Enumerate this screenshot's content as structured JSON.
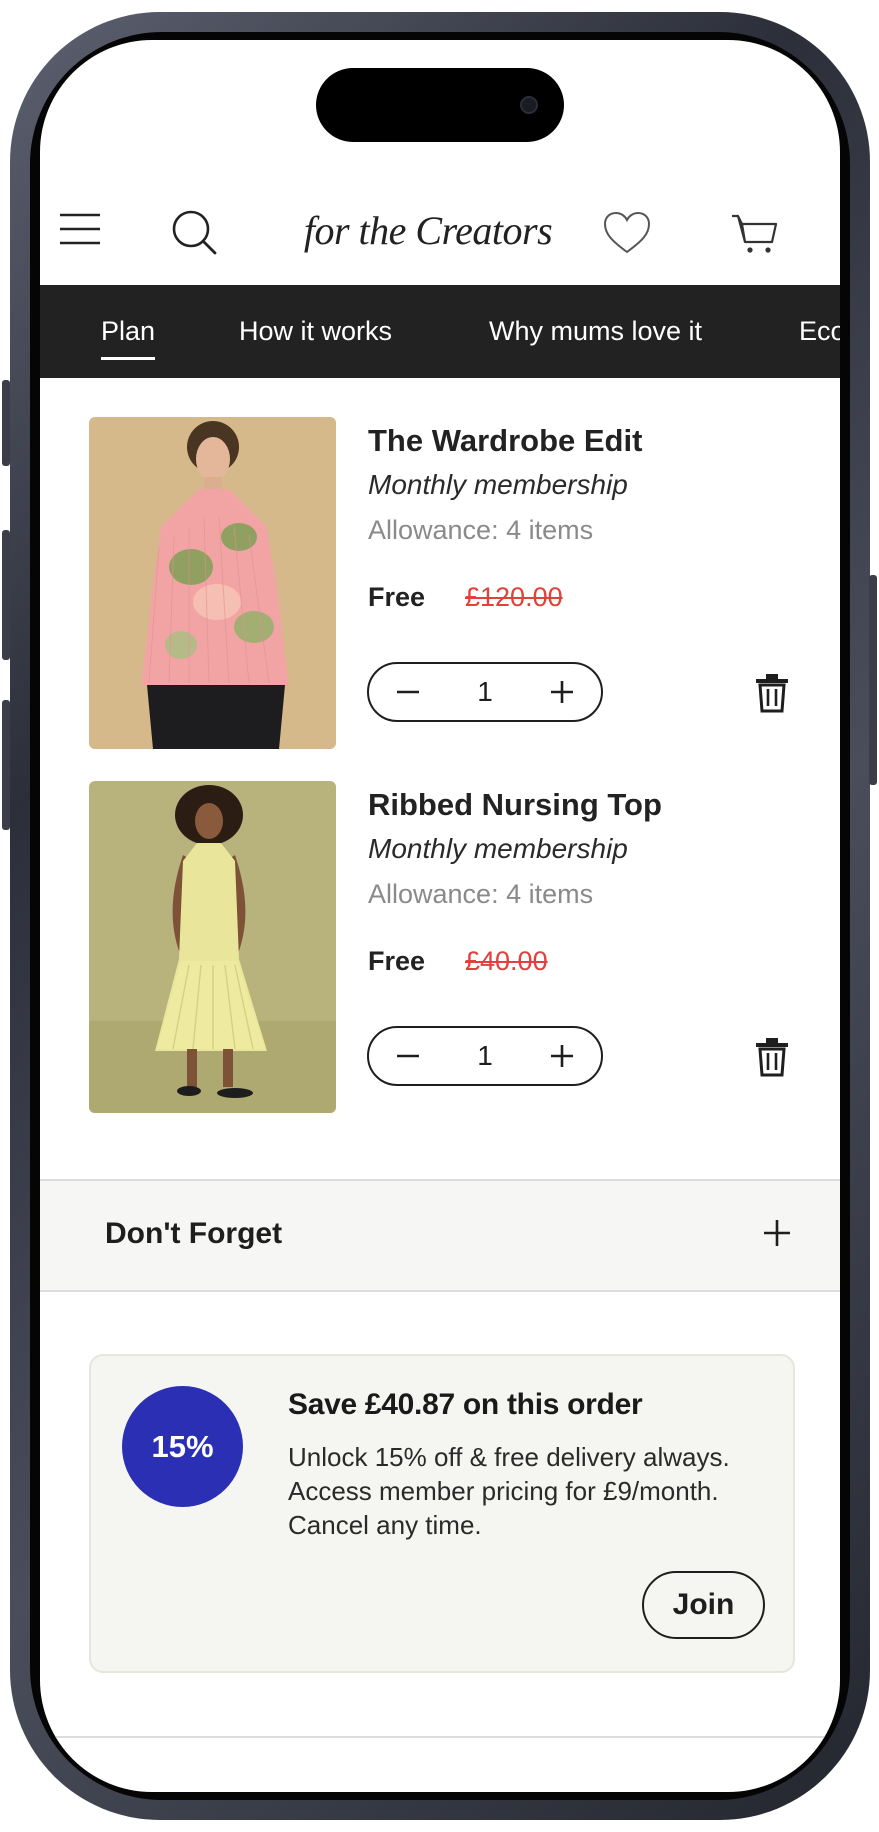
{
  "brand": {
    "logo_text": "for the Creators"
  },
  "header": {
    "icons": [
      "menu-icon",
      "search-icon",
      "heart-icon",
      "cart-icon"
    ]
  },
  "nav": {
    "tabs": [
      {
        "label": "Plan",
        "active": true
      },
      {
        "label": "How it works",
        "active": false
      },
      {
        "label": "Why mums love it",
        "active": false
      },
      {
        "label": "Eco",
        "active": false
      }
    ]
  },
  "cart": {
    "items": [
      {
        "name": "The Wardrobe Edit",
        "plan": "Monthly membership",
        "allowance": "Allowance: 4 items",
        "price": "Free",
        "original_price": "£120.00",
        "quantity": "1"
      },
      {
        "name": "Ribbed Nursing Top",
        "plan": "Monthly membership",
        "allowance": "Allowance: 4 items",
        "price": "Free",
        "original_price": "£40.00",
        "quantity": "1"
      }
    ]
  },
  "dont_forget": {
    "label": "Don't Forget"
  },
  "promo": {
    "badge": "15%",
    "title": "Save £40.87 on this order",
    "body": "Unlock 15% off & free delivery always. Access member pricing for £9/month. Cancel any time.",
    "button_label": "Join"
  },
  "colors": {
    "nav_bg": "#222222",
    "price_strike": "#e0413a",
    "badge_bg": "#2b2fb4",
    "promo_bg": "#f5f5f1"
  }
}
